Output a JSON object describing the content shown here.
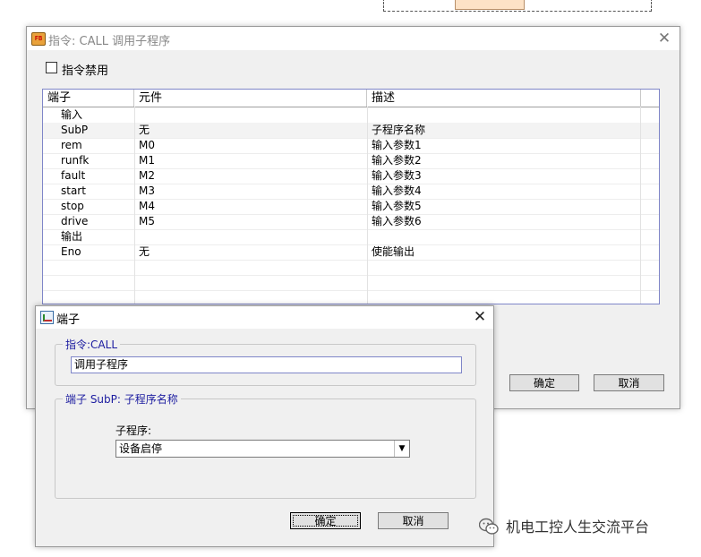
{
  "main_dialog": {
    "title": "指令: CALL 调用子程序",
    "disable_checkbox_label": "指令禁用",
    "columns": [
      "端子",
      "元件",
      "描述"
    ],
    "rows": [
      {
        "terminal": "输入",
        "element": "",
        "desc": ""
      },
      {
        "terminal": "SubP",
        "element": "无",
        "desc": "子程序名称"
      },
      {
        "terminal": "rem",
        "element": "M0",
        "desc": "输入参数1"
      },
      {
        "terminal": "runfk",
        "element": "M1",
        "desc": "输入参数2"
      },
      {
        "terminal": "fault",
        "element": "M2",
        "desc": "输入参数3"
      },
      {
        "terminal": "start",
        "element": "M3",
        "desc": "输入参数4"
      },
      {
        "terminal": "stop",
        "element": "M4",
        "desc": "输入参数5"
      },
      {
        "terminal": "drive",
        "element": "M5",
        "desc": "输入参数6"
      },
      {
        "terminal": "输出",
        "element": "",
        "desc": ""
      },
      {
        "terminal": "Eno",
        "element": "无",
        "desc": "使能输出"
      },
      {
        "terminal": "",
        "element": "",
        "desc": ""
      },
      {
        "terminal": "",
        "element": "",
        "desc": ""
      }
    ],
    "ok_label": "确定",
    "cancel_label": "取消"
  },
  "sub_dialog": {
    "title": "端子",
    "instruction_group_label": "指令:CALL",
    "instruction_value": "调用子程序",
    "terminal_group_label": "端子 SubP: 子程序名称",
    "subprogram_label": "子程序:",
    "subprogram_value": "设备启停",
    "ok_label": "确定",
    "cancel_label": "取消"
  },
  "watermark": {
    "text": "机电工控人生交流平台"
  },
  "icons": {
    "main_icon": "fb-block-icon",
    "sub_icon": "terminal-chart-icon",
    "close": "close-icon",
    "dropdown": "chevron-down-icon",
    "watermark": "wechat-icon"
  }
}
